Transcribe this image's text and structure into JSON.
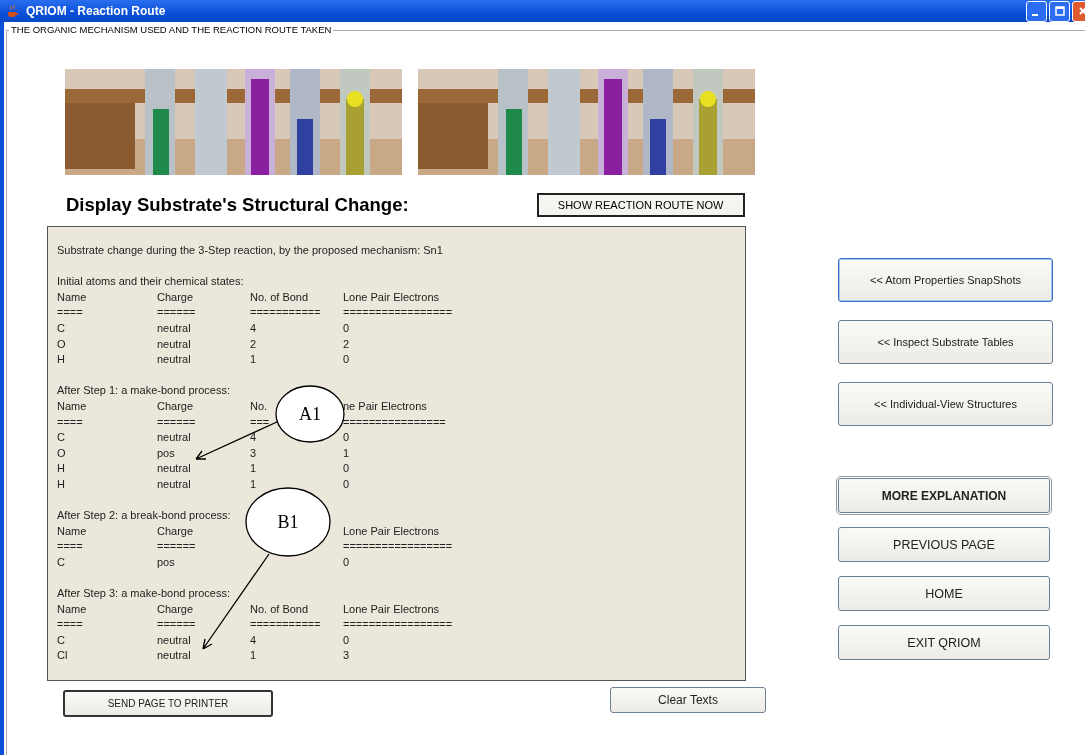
{
  "window": {
    "title": "QRIOM - Reaction Route"
  },
  "group_title": "THE ORGANIC MECHANISM USED AND THE REACTION ROUTE TAKEN",
  "heading": "Display Substrate's Structural Change:",
  "show_button": "SHOW REACTION ROUTE NOW",
  "output": {
    "intro": "Substrate change during the 3-Step reaction, by the proposed mechanism: Sn1",
    "sections": [
      {
        "heading": "Initial atoms and their chemical states:",
        "rows": [
          {
            "name": "Name",
            "charge": "Charge",
            "bonds": "No. of Bond",
            "lone_pairs": "Lone Pair Electrons"
          },
          {
            "name": "====",
            "charge": "======",
            "bonds": "===========",
            "lone_pairs": "================="
          },
          {
            "name": "C",
            "charge": "neutral",
            "bonds": "4",
            "lone_pairs": "0"
          },
          {
            "name": "O",
            "charge": "neutral",
            "bonds": "2",
            "lone_pairs": "2"
          },
          {
            "name": "H",
            "charge": "neutral",
            "bonds": "1",
            "lone_pairs": "0"
          }
        ]
      },
      {
        "heading": "After Step 1: a make-bond process:",
        "rows": [
          {
            "name": "Name",
            "charge": "Charge",
            "bonds": "No.",
            "lone_pairs": "ne Pair Electrons"
          },
          {
            "name": "====",
            "charge": "======",
            "bonds": "===",
            "lone_pairs": "================"
          },
          {
            "name": "C",
            "charge": "neutral",
            "bonds": "4",
            "lone_pairs": "0"
          },
          {
            "name": "O",
            "charge": "pos",
            "bonds": "3",
            "lone_pairs": "1"
          },
          {
            "name": "H",
            "charge": "neutral",
            "bonds": "1",
            "lone_pairs": "0"
          },
          {
            "name": "H",
            "charge": "neutral",
            "bonds": "1",
            "lone_pairs": "0"
          }
        ]
      },
      {
        "heading": "After Step 2: a break-bond process:",
        "rows": [
          {
            "name": "Name",
            "charge": "Charge",
            "lone_pairs": "Lone Pair Electrons"
          },
          {
            "name": "====",
            "charge": "======",
            "lone_pairs": "================="
          },
          {
            "name": "C",
            "charge": "pos",
            "lone_pairs": "0"
          }
        ]
      },
      {
        "heading": "After Step 3: a make-bond process:",
        "rows": [
          {
            "name": "Name",
            "charge": "Charge",
            "bonds": "No. of Bond",
            "lone_pairs": "Lone Pair Electrons"
          },
          {
            "name": "====",
            "charge": "======",
            "bonds": "===========",
            "lone_pairs": "================="
          },
          {
            "name": "C",
            "charge": "neutral",
            "bonds": "4",
            "lone_pairs": "0"
          },
          {
            "name": "Cl",
            "charge": "neutral",
            "bonds": "1",
            "lone_pairs": "3"
          }
        ]
      }
    ]
  },
  "callouts": [
    {
      "label": "A1"
    },
    {
      "label": "B1"
    }
  ],
  "side_buttons": [
    {
      "label": "<< Atom Properties SnapShots",
      "kind": "highlighted"
    },
    {
      "label": "<< Inspect Substrate Tables",
      "kind": "normal"
    },
    {
      "label": "<<  Individual-View Structures",
      "kind": "normal"
    }
  ],
  "nav_buttons": [
    {
      "label": "MORE EXPLANATION",
      "kind": "default"
    },
    {
      "label": "PREVIOUS PAGE",
      "kind": "normal"
    },
    {
      "label": "HOME",
      "kind": "normal"
    },
    {
      "label": "EXIT QRIOM",
      "kind": "normal"
    }
  ],
  "print_button": "SEND PAGE TO PRINTER",
  "clear_button": "Clear Texts"
}
